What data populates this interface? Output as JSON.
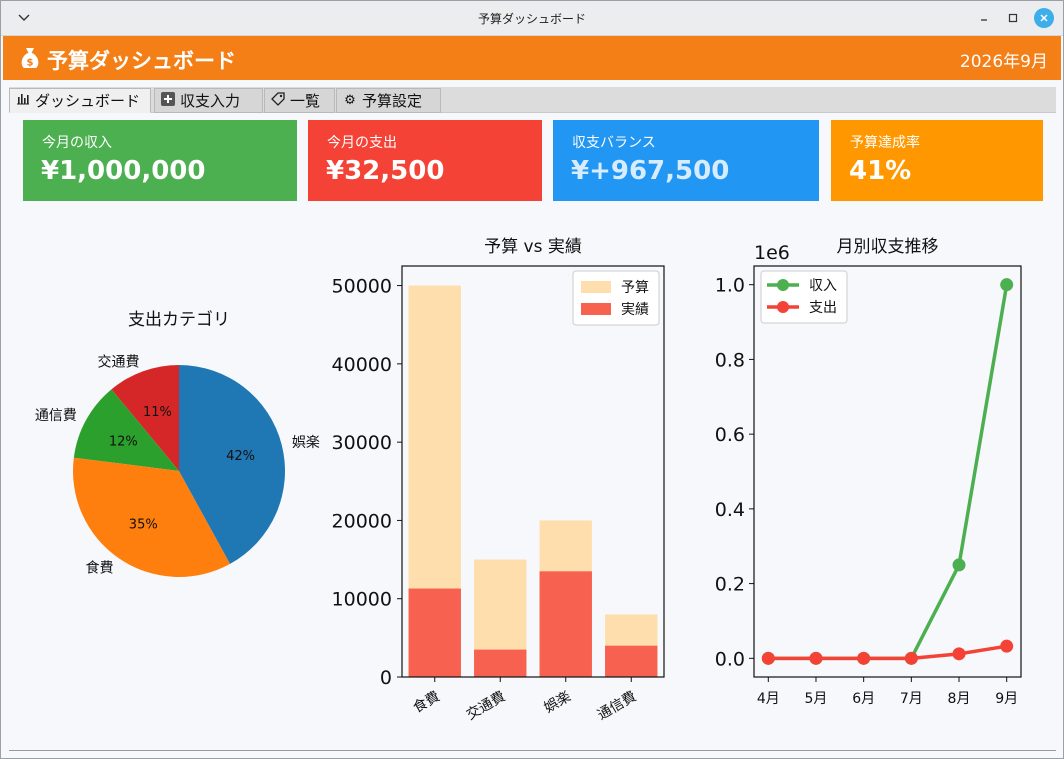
{
  "window": {
    "title": "予算ダッシュボード"
  },
  "header": {
    "title": "予算ダッシュボード",
    "month": "2026年9月"
  },
  "tabs": [
    {
      "label": "ダッシュボード",
      "icon": "bar-chart-icon"
    },
    {
      "label": "収支入力",
      "icon": "plus-icon"
    },
    {
      "label": "一覧",
      "icon": "tag-icon"
    },
    {
      "label": "予算設定",
      "icon": "gear-icon"
    }
  ],
  "cards": [
    {
      "label": "今月の収入",
      "value": "¥1,000,000",
      "color": "#4caf50"
    },
    {
      "label": "今月の支出",
      "value": "¥32,500",
      "color": "#f44336"
    },
    {
      "label": "収支バランス",
      "value": "¥+967,500",
      "color": "#2196f3"
    },
    {
      "label": "予算達成率",
      "value": "41%",
      "color": "#ff9800"
    }
  ],
  "chart_data": [
    {
      "type": "pie",
      "title": "支出カテゴリ",
      "labels": [
        "交通費",
        "通信費",
        "食費",
        "娯楽"
      ],
      "values": [
        11,
        12,
        35,
        42
      ],
      "value_labels": [
        "11%",
        "12%",
        "35%",
        "42%"
      ],
      "colors": [
        "#d62728",
        "#2ca02c",
        "#ff7f0e",
        "#1f77b4"
      ]
    },
    {
      "type": "bar",
      "title": "予算 vs 実績",
      "categories": [
        "食費",
        "交通費",
        "娯楽",
        "通信費"
      ],
      "series": [
        {
          "name": "予算",
          "values": [
            50000,
            15000,
            20000,
            8000
          ],
          "color": "#ffdead"
        },
        {
          "name": "実績",
          "values": [
            11300,
            3500,
            13500,
            4000
          ],
          "color": "#f76150"
        }
      ],
      "yticks": [
        0,
        10000,
        20000,
        30000,
        40000,
        50000
      ],
      "ytick_labels": [
        "0",
        "10000",
        "20000",
        "30000",
        "40000",
        "50000"
      ],
      "ylim": [
        0,
        52500
      ],
      "legend": "top-right"
    },
    {
      "type": "line",
      "title": "月別収支推移",
      "x": [
        "4月",
        "5月",
        "6月",
        "7月",
        "8月",
        "9月"
      ],
      "series": [
        {
          "name": "収入",
          "values": [
            0,
            0,
            0,
            0,
            250000,
            1000000
          ],
          "color": "#4caf50"
        },
        {
          "name": "支出",
          "values": [
            0,
            0,
            0,
            0,
            12000,
            32500
          ],
          "color": "#f44336"
        }
      ],
      "yticks": [
        0,
        0.2,
        0.4,
        0.6,
        0.8,
        1.0
      ],
      "ytick_labels": [
        "0.0",
        "0.2",
        "0.4",
        "0.6",
        "0.8",
        "1.0"
      ],
      "offset_label": "1e6",
      "ylim": [
        -0.05,
        1.05
      ],
      "legend": "top-left"
    }
  ]
}
